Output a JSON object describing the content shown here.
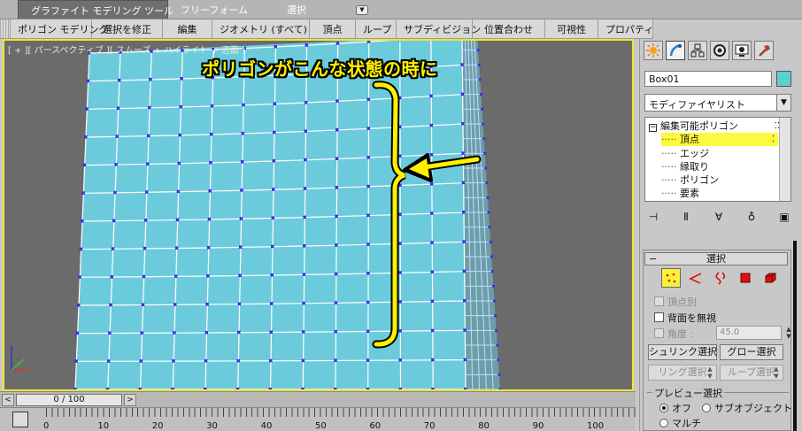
{
  "ribbon": {
    "tabs": [
      {
        "label": "グラファイト モデリング ツール",
        "active": true
      },
      {
        "label": "フリーフォーム",
        "active": false
      },
      {
        "label": "選択",
        "active": false
      }
    ],
    "buttons": [
      "ポリゴン モデリング",
      "選択を修正",
      "編集",
      "ジオメトリ (すべて)",
      "頂点",
      "ループ",
      "サブディビジョン",
      "位置合わせ",
      "可視性",
      "プロパティ"
    ]
  },
  "viewport": {
    "label": "[ + ][ パースペクティブ ][ スムーズ + ハイライト + 辺面 ]",
    "annotation": "ポリゴンがこんな状態の時に",
    "colors": {
      "mesh": "#6ccbdb",
      "vertex": "#3b2cf0",
      "border": "#f2e531",
      "annotation": "#fff000"
    }
  },
  "timeline": {
    "slider_label": "0 / 100",
    "prev": "<",
    "next": ">",
    "ticks": [
      "0",
      "10",
      "20",
      "30",
      "40",
      "50",
      "60",
      "70",
      "80",
      "90",
      "100"
    ]
  },
  "panel": {
    "object_name": "Box01",
    "object_color": "#5ecfd0",
    "modifier_list": "モディファイヤリスト",
    "stack": [
      {
        "label": "編集可能ポリゴン",
        "type": "root",
        "selected": false
      },
      {
        "label": "頂点",
        "type": "child",
        "selected": true
      },
      {
        "label": "エッジ",
        "type": "child",
        "selected": false
      },
      {
        "label": "縁取り",
        "type": "child",
        "selected": false
      },
      {
        "label": "ポリゴン",
        "type": "child",
        "selected": false
      },
      {
        "label": "要素",
        "type": "child",
        "selected": false
      }
    ],
    "selection": {
      "title": "選択",
      "by_vertex": "頂点別",
      "ignore_backfacing": "背面を無視",
      "angle_label": "角度 :",
      "angle_value": "45.0",
      "shrink": "シュリンク選択",
      "grow": "グロー選択",
      "ring": "リング選択",
      "loop": "ループ選択",
      "preview_title": "プレビュー選択",
      "preview_options": [
        "オフ",
        "サブオブジェクト",
        "マルチ"
      ],
      "preview_selected": "オフ"
    }
  }
}
